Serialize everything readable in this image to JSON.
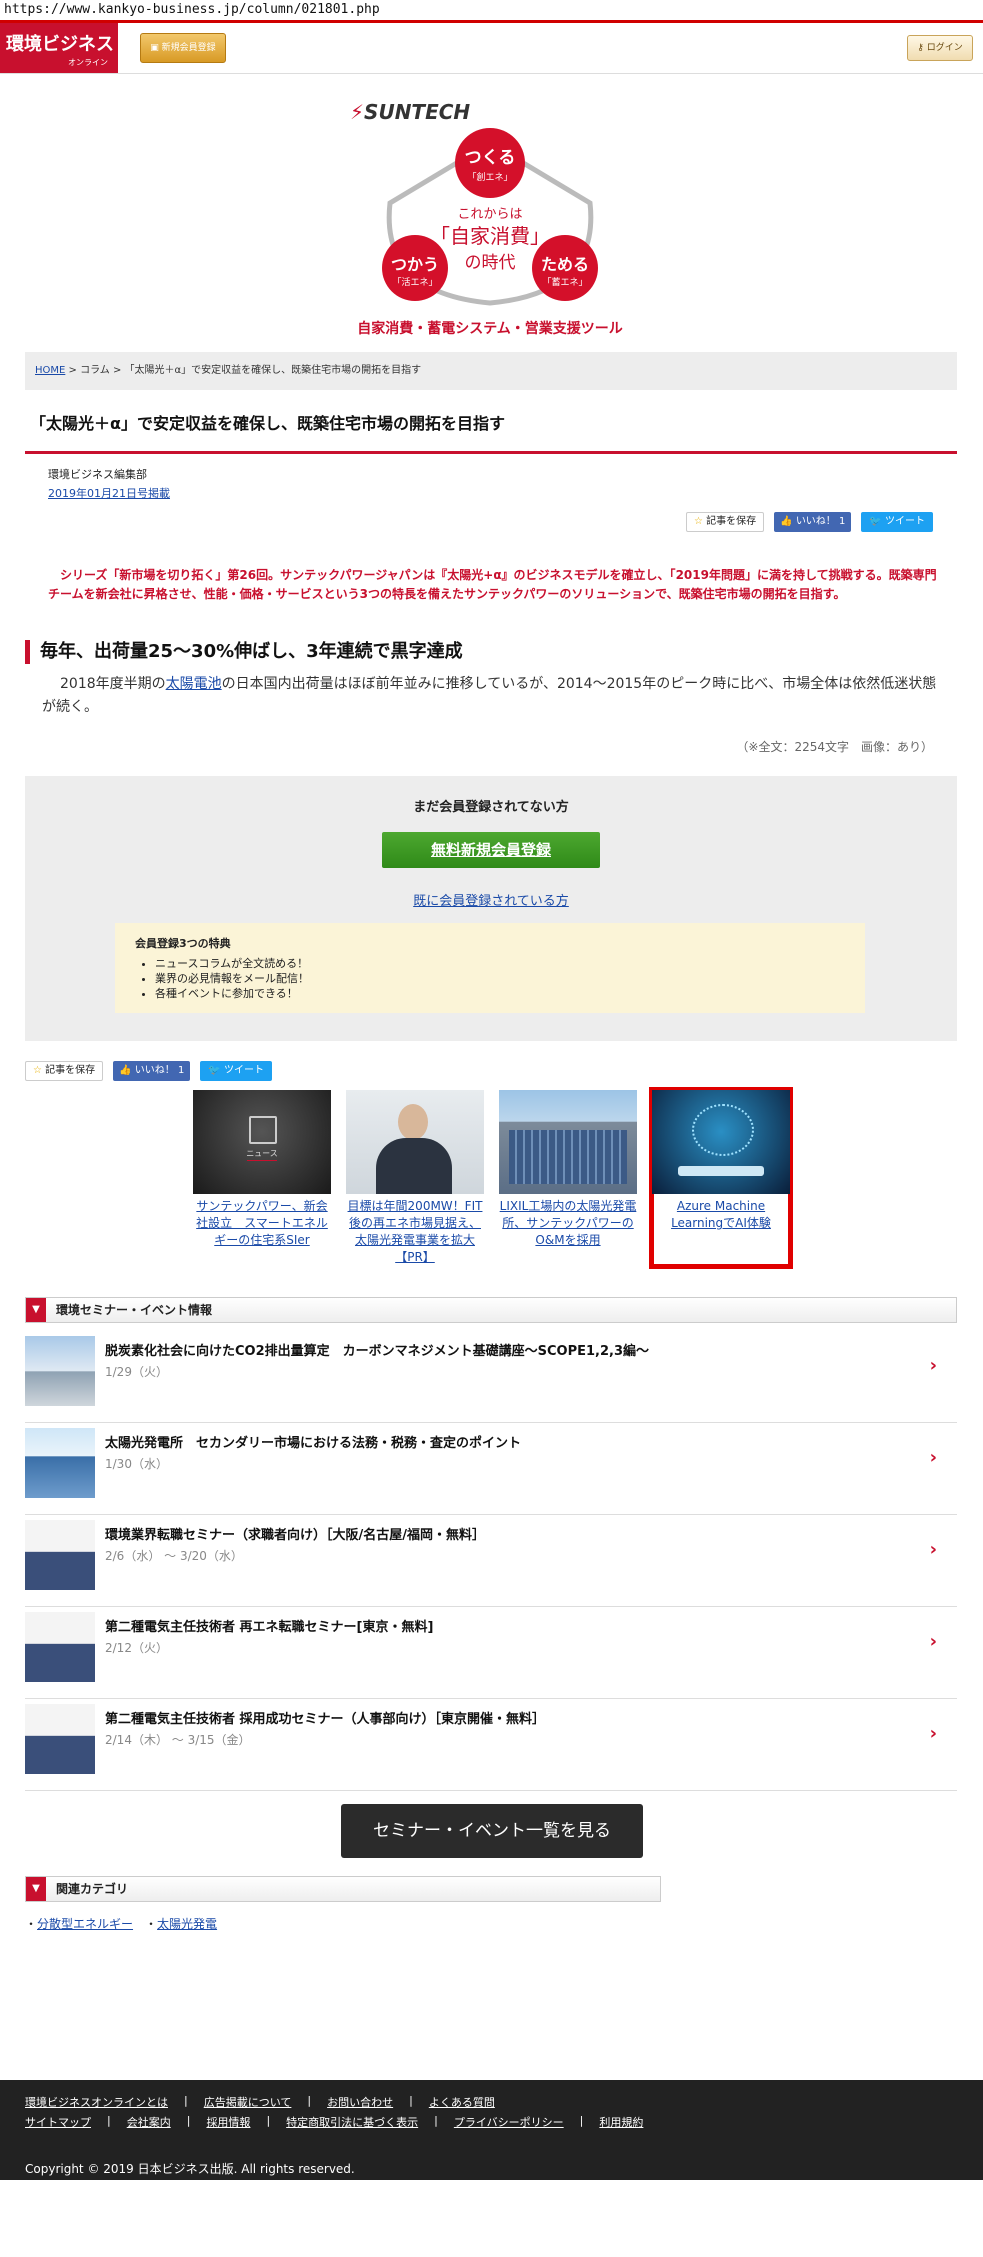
{
  "url": "https://www.kankyo-business.jp/column/021801.php",
  "header": {
    "logo_main": "環境ビジネス",
    "logo_sub": "オンライン",
    "register_label": "新規会員登録",
    "login_label": "ログイン"
  },
  "banner": {
    "brand": "SUNTECH",
    "tagline": "自家消費・蓄電システム・営業支援ツール",
    "circle_top": "つくる",
    "circle_top_sub": "「創エネ」",
    "circle_left": "つかう",
    "circle_left_sub": "「活エネ」",
    "circle_right": "ためる",
    "circle_right_sub": "「蓄エネ」",
    "center_1": "これからは",
    "center_2": "「自家消費」",
    "center_3": "の時代"
  },
  "breadcrumb": {
    "home": "HOME",
    "sep1": " > ",
    "column": "コラム",
    "sep2": " > ",
    "current": "「太陽光＋α」で安定収益を確保し、既築住宅市場の開拓を目指す"
  },
  "article": {
    "title": "「太陽光＋α」で安定収益を確保し、既築住宅市場の開拓を目指す",
    "author": "環境ビジネス編集部",
    "date": "2019年01月21日号掲載",
    "lead": "シリーズ「新市場を切り拓く」第26回。サンテックパワージャパンは『太陽光+α』のビジネスモデルを確立し、「2019年問題」に満を持して挑戦する。既築専門チームを新会社に昇格させ、性能・価格・サービスという3つの特長を備えたサンテックパワーのソリューションで、既築住宅市場の開拓を目指す。",
    "heading": "毎年、出荷量25～30%伸ばし、3年連続で黒字達成",
    "body_pre": "2018年度半期の",
    "body_link": "太陽電池",
    "body_post": "の日本国内出荷量はほぼ前年並みに推移しているが、2014～2015年のピーク時に比べ、市場全体は依然低迷状態が続く。",
    "count": "（※全文：2254文字　画像：あり）"
  },
  "share": {
    "save": "記事を保存",
    "like": "いいね！ 1",
    "tweet": "ツイート"
  },
  "member": {
    "question": "まだ会員登録されてない方",
    "free_button": "無料新規会員登録",
    "already": "既に会員登録されている方",
    "benefit_title": "会員登録3つの特典",
    "benefits": [
      "ニュースコラムが全文読める！",
      "業界の必見情報をメール配信！",
      "各種イベントに参加できる！"
    ]
  },
  "related": [
    {
      "caption": "サンテックパワー、新会社設立　スマートエネルギーの住宅系SIer",
      "badge": "ニュース"
    },
    {
      "caption": "目標は年間200MW！FIT後の再エネ市場見据え、太陽光発電事業を拡大【PR】"
    },
    {
      "caption": "LIXIL工場内の太陽光発電所、サンテックパワーのO&Mを採用"
    },
    {
      "caption": "Azure Machine LearningでAI体験"
    }
  ],
  "seminar": {
    "heading": "環境セミナー・イベント情報",
    "events": [
      {
        "title": "脱炭素化社会に向けたCO2排出量算定　カーボンマネジメント基礎講座～SCOPE1,2,3編～",
        "date": "1/29（火）"
      },
      {
        "title": "太陽光発電所　セカンダリー市場における法務・税務・査定のポイント",
        "date": "1/30（水）"
      },
      {
        "title": "環境業界転職セミナー（求職者向け）［大阪/名古屋/福岡・無料］",
        "date": "2/6（水） ～ 3/20（水）"
      },
      {
        "title": "第二種電気主任技術者 再エネ転職セミナー[東京・無料]",
        "date": "2/12（火）"
      },
      {
        "title": "第二種電気主任技術者 採用成功セミナー（人事部向け）［東京開催・無料］",
        "date": "2/14（木） ～ 3/15（金）"
      }
    ],
    "all_button": "セミナー・イベント一覧を見る"
  },
  "category": {
    "heading": "関連カテゴリ",
    "items": [
      "分散型エネルギー",
      "太陽光発電"
    ]
  },
  "footer": {
    "row1": [
      "環境ビジネスオンラインとは",
      "広告掲載について",
      "お問い合わせ",
      "よくある質問"
    ],
    "row2": [
      "サイトマップ",
      "会社案内",
      "採用情報",
      "特定商取引法に基づく表示",
      "プライバシーポリシー",
      "利用規約"
    ],
    "copyright": "Copyright © 2019 日本ビジネス出版. All rights reserved."
  }
}
